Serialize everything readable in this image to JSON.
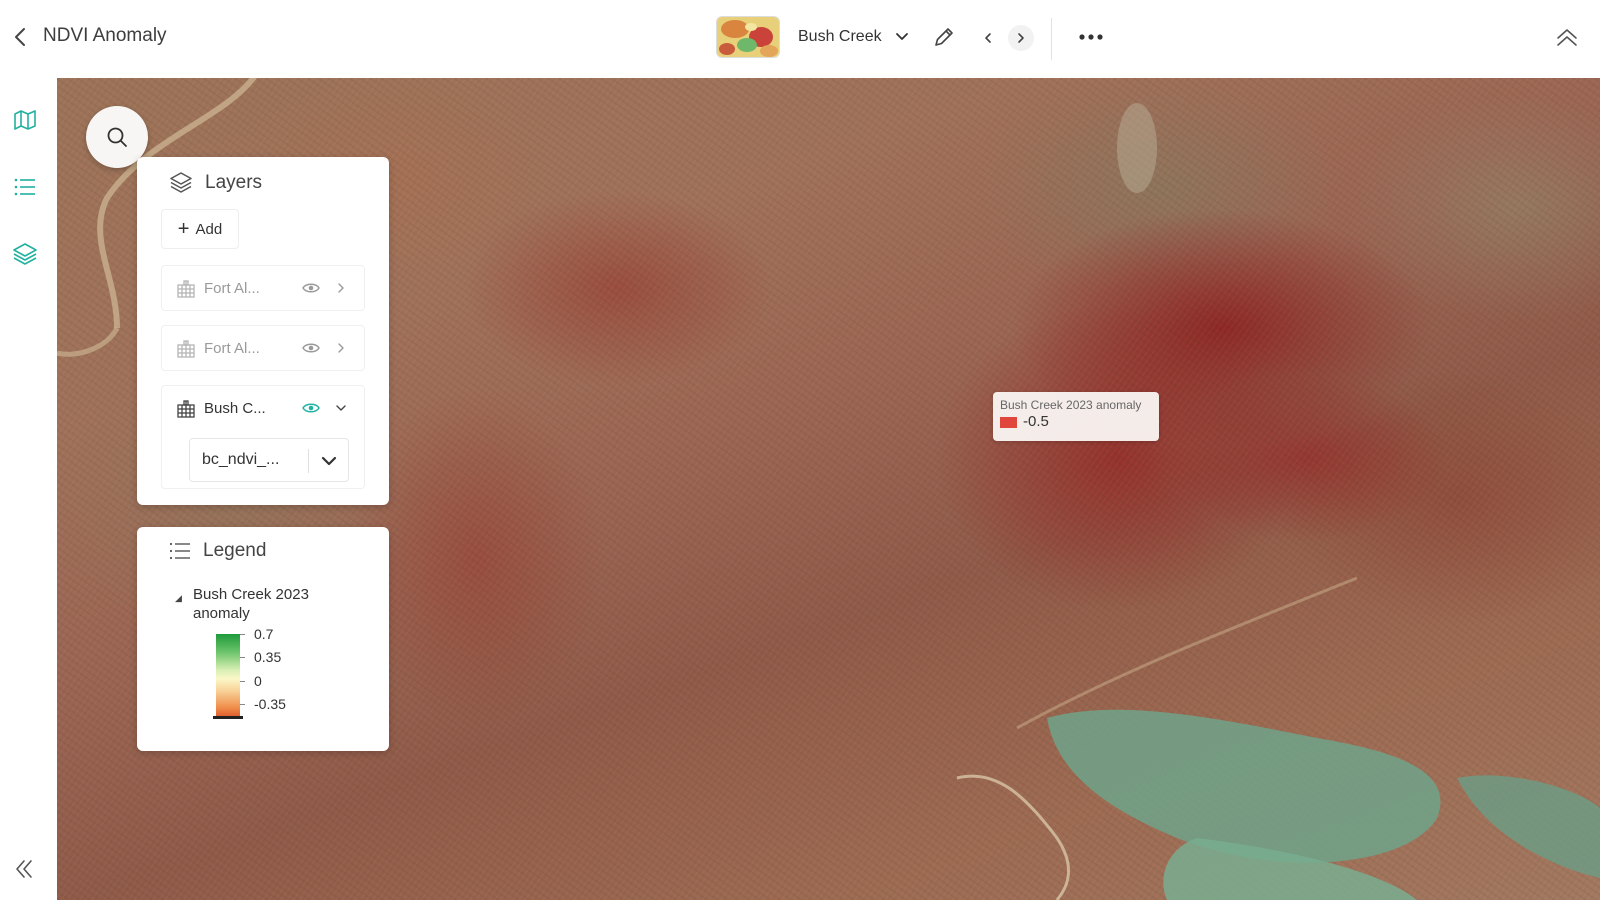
{
  "header": {
    "title": "NDVI Anomaly",
    "project_name": "Bush Creek"
  },
  "layers_panel": {
    "title": "Layers",
    "add_label": "Add",
    "layers": [
      {
        "name": "Fort Al...",
        "visible": false,
        "expanded": false
      },
      {
        "name": "Fort Al...",
        "visible": false,
        "expanded": false
      },
      {
        "name": "Bush C...",
        "visible": true,
        "expanded": true,
        "band": "bc_ndvi_..."
      }
    ]
  },
  "legend_panel": {
    "title": "Legend",
    "layer_name": "Bush Creek 2023 anomaly",
    "stops": [
      "0.7",
      "0.35",
      "0",
      "-0.35"
    ]
  },
  "tooltip": {
    "title": "Bush Creek 2023 anomaly",
    "value": "-0.5",
    "swatch_color": "#e0463c"
  },
  "colors": {
    "accent": "#22b0a0",
    "visible_eye": "#1fb3a3"
  }
}
